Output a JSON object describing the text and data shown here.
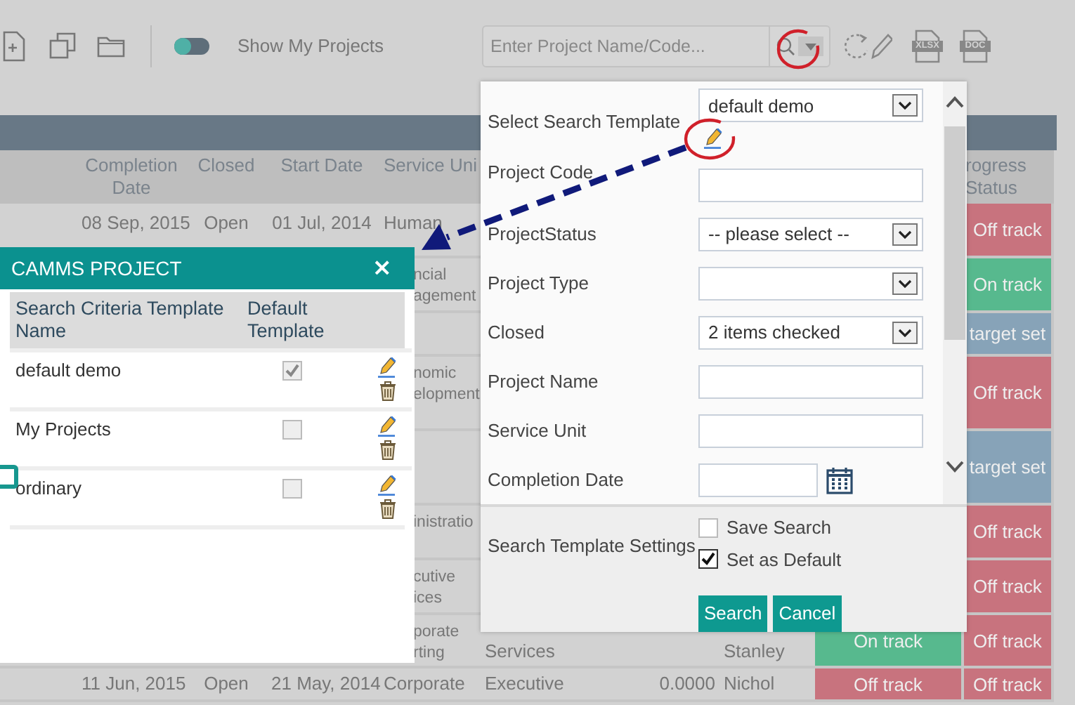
{
  "toolbar": {
    "show_my_projects": {
      "label": "Show My Projects",
      "on": false
    },
    "search": {
      "placeholder": "Enter Project Name/Code..."
    },
    "exports": [
      {
        "label": "XLSX"
      },
      {
        "label": "DOC"
      }
    ]
  },
  "table": {
    "headers": {
      "completion_date": "Completion Date",
      "closed": "Closed",
      "start_date": "Start Date",
      "service_unit": "Service Uni",
      "progress_status": "rogress Status"
    },
    "rows": [
      {
        "completion_date": "08 Sep, 2015",
        "closed": "Open",
        "start_date": "01 Jul, 2014",
        "service_unit": "Human",
        "progress_status": {
          "label": "Off track",
          "color": "#c8737e"
        }
      },
      {
        "service_unit": "ncial agement",
        "progress_status": {
          "label": "On track",
          "color": "#57b98e"
        }
      },
      {
        "progress_status": {
          "label": "target set",
          "color": "#87a3b8"
        }
      },
      {
        "service_unit": "nomic elopment",
        "progress_status": {
          "label": "Off track",
          "color": "#c8737e"
        }
      },
      {
        "progress_status": {
          "label": "target set",
          "color": "#87a3b8"
        }
      },
      {
        "service_unit": "inistratio",
        "progress_status": {
          "label": "Off track",
          "color": "#c8737e"
        }
      },
      {
        "service_unit": "cutive ices",
        "progress_status": {
          "label": "Off track",
          "color": "#c8737e"
        }
      },
      {
        "service_unit": "porate rting",
        "column_6": "Services",
        "column_8": "Stanley",
        "column_9": {
          "label": "On track",
          "color": "#57b98e"
        },
        "progress_status": {
          "label": "Off track",
          "color": "#c8737e"
        }
      },
      {
        "completion_date": "11 Jun, 2015",
        "closed": "Open",
        "start_date": "21 May, 2014",
        "service_unit": "Corporate",
        "column_6": "Executive",
        "column_7": "0.0000",
        "column_8": "Nichol",
        "column_9": {
          "label": "Off track",
          "color": "#c8737e"
        },
        "progress_status": {
          "label": "Off track",
          "color": "#c8737e"
        }
      }
    ]
  },
  "dialog": {
    "title": "CAMMS PROJECT",
    "close": "×",
    "columns": [
      "Search Criteria Template Name",
      "Default Template"
    ],
    "rows": [
      {
        "name": "default demo",
        "checked": true
      },
      {
        "name": "My Projects",
        "checked": false
      },
      {
        "name": "ordinary",
        "checked": false
      }
    ]
  },
  "search_panel": {
    "fields": [
      {
        "label": "Select Search Template",
        "kind": "select",
        "value": "default demo"
      },
      {
        "label": "Project Code",
        "kind": "text"
      },
      {
        "label": "ProjectStatus",
        "kind": "select",
        "value": "-- please select --"
      },
      {
        "label": "Project Type",
        "kind": "select"
      },
      {
        "label": "Closed",
        "kind": "select",
        "value": "2 items checked"
      },
      {
        "label": "Project Name",
        "kind": "text"
      },
      {
        "label": "Service Unit",
        "kind": "text"
      },
      {
        "label": "Completion Date",
        "kind": "date"
      }
    ],
    "settings": {
      "label": "Search Template Settings",
      "options": [
        {
          "label": "Save Search",
          "checked": false
        },
        {
          "label": "Set as Default",
          "checked": true
        }
      ]
    },
    "buttons": [
      "Search",
      "Cancel"
    ]
  }
}
